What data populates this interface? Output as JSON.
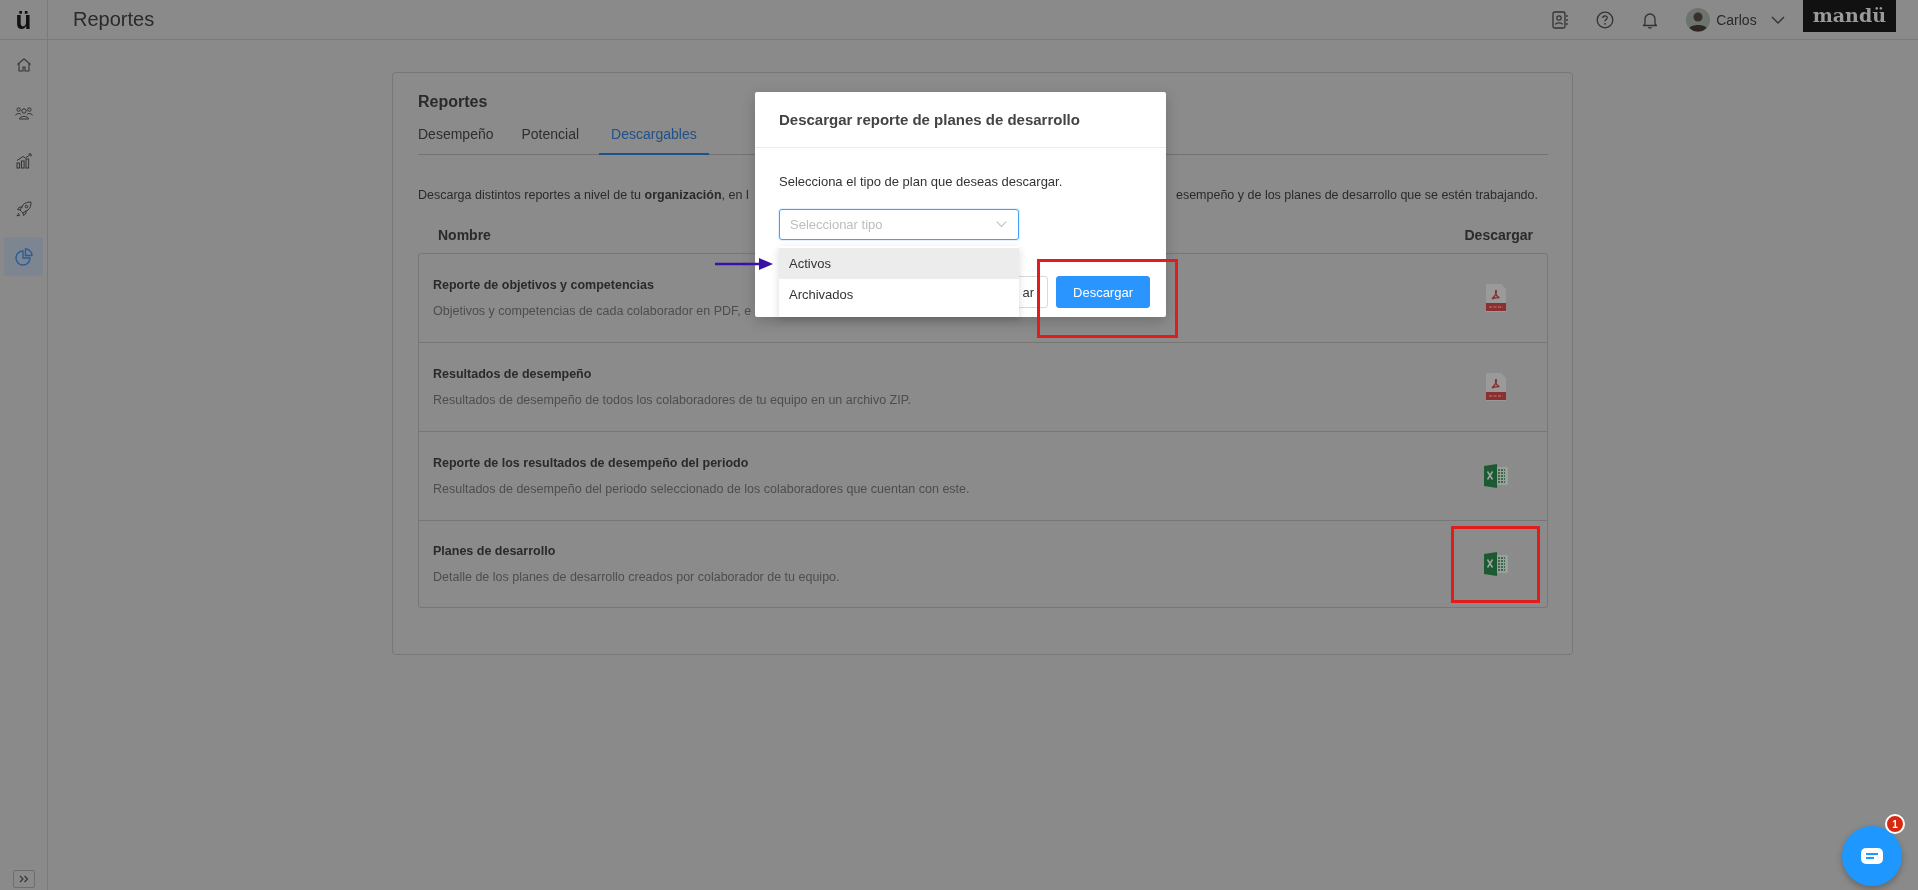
{
  "app": {
    "logo": "ü",
    "page_title": "Reportes"
  },
  "header": {
    "user_name": "Carlos",
    "brand": "mandü"
  },
  "sidebar": {
    "items": [
      {
        "kind": "home",
        "selected": false
      },
      {
        "kind": "people",
        "selected": false
      },
      {
        "kind": "chart",
        "selected": false
      },
      {
        "kind": "rocket",
        "selected": false
      },
      {
        "kind": "pie",
        "selected": true
      }
    ]
  },
  "card": {
    "title": "Reportes",
    "tabs": [
      {
        "label": "Desempeño",
        "selected": false
      },
      {
        "label": "Potencial",
        "selected": false
      },
      {
        "label": "Descargables",
        "selected": true
      }
    ],
    "intro_left": "Descarga distintos reportes a nivel de tu **organización**, en l",
    "intro_right": "esempeño y de los planes de desarrollo que se estén trabajando.",
    "columns": [
      "Nombre",
      "Descargar"
    ],
    "rows": [
      {
        "title": "Reporte de objetivos y competencias",
        "description": "Objetivos y competencias de cada colaborador en PDF, e",
        "kind": "pdf"
      },
      {
        "title": "Resultados de desempeño",
        "description": "Resultados de desempeño de todos los colaboradores de tu equipo en un archivo ZIP.",
        "kind": "pdf"
      },
      {
        "title": "Reporte de los resultados de desempeño del periodo",
        "description": "Resultados de desempeño del periodo seleccionado de los colaboradores que cuentan con este.",
        "kind": "excel"
      },
      {
        "title": "Planes de desarrollo",
        "description": "Detalle de los planes de desarrollo creados por colaborador de tu equipo.",
        "kind": "excel"
      }
    ]
  },
  "modal": {
    "title": "Descargar reporte de planes de desarrollo",
    "prompt": "Selecciona el tipo de plan que deseas descargar.",
    "select": {
      "placeholder": "Seleccionar tipo"
    },
    "options": [
      {
        "label": "Activos",
        "highlighted": true
      },
      {
        "label": "Archivados",
        "highlighted": false
      }
    ],
    "buttons": [
      {
        "label": "ar",
        "kind": "secondary"
      },
      {
        "label": "Descargar",
        "kind": "primary"
      }
    ]
  },
  "annotations": [
    {
      "kind": "arrow"
    },
    {
      "kind": "frame"
    },
    {
      "kind": "frame"
    }
  ],
  "chat": {
    "badge": "1"
  }
}
